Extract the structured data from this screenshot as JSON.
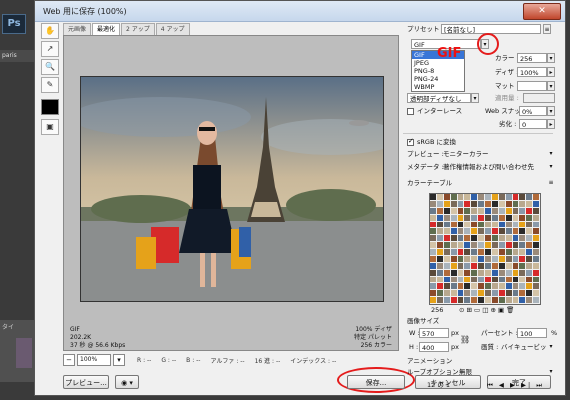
{
  "app": {
    "logo": "Ps",
    "left_tab": "paris",
    "left_bottom_label": "タイ",
    "dialog_title": "Web 用に保存 (100%)",
    "close_glyph": "✕"
  },
  "tools": [
    "hand-icon",
    "slice-select-icon",
    "zoom-icon",
    "eyedropper-icon"
  ],
  "tabs": [
    "元画像",
    "最適化",
    "2 アップ",
    "4 アップ"
  ],
  "preview": {
    "format": "GIF",
    "size": "202.2K",
    "time": "37 秒 @ 56.6 Kbps",
    "dither": "100% ディザ",
    "palette": "特定 パレット",
    "colors": "256 カラー"
  },
  "statusbar": {
    "zoom": "100%",
    "r": "R : --",
    "g": "G : --",
    "b": "B : --",
    "alpha": "アルファ : --",
    "hex": "16 進 : --",
    "index": "インデックス : --"
  },
  "bottom_buttons": {
    "preview": "プレビュー...",
    "save": "保存...",
    "cancel": "キャンセル",
    "done": "完了"
  },
  "settings": {
    "preset_label": "プリセット :",
    "preset_value": "[名前なし]",
    "format_value": "GIF",
    "format_options": [
      "GIF",
      "JPEG",
      "PNG-8",
      "PNG-24",
      "WBMP"
    ],
    "gif_annotation": "GIF",
    "colors_label": "カラー :",
    "colors_value": "256",
    "dither_label": "ディザ :",
    "dither_value": "100%",
    "matte_label": "マット :",
    "transparency_dither": "透明部ディザなし",
    "amount_label": "適用量 :",
    "interlace_label": "インターレース",
    "web_snap_label": "Web スナップ :",
    "web_snap_value": "0%",
    "lossy_label": "劣化 :",
    "lossy_value": "0",
    "srgb_label": "sRGB に変換",
    "preview_label": "プレビュー :",
    "preview_value": "モニターカラー",
    "metadata_label": "メタデータ :",
    "metadata_value": "著作権情報および問い合わせ先",
    "color_table_label": "カラーテーブル",
    "color_count": "256",
    "image_size_label": "画像サイズ",
    "w_label": "W :",
    "w_value": "570",
    "h_label": "H :",
    "h_value": "400",
    "px": "px",
    "percent_label": "パーセント :",
    "percent_value": "100",
    "percent_unit": "%",
    "quality_label": "画質 :",
    "quality_value": "バイキュービック法",
    "animation_label": "アニメーション",
    "loop_label": "ループオプション :",
    "loop_value": "無限",
    "frame_counter": "12 の 1"
  },
  "colors": {
    "annotation_red": "#e41c1c",
    "selection_blue": "#3875d7"
  }
}
